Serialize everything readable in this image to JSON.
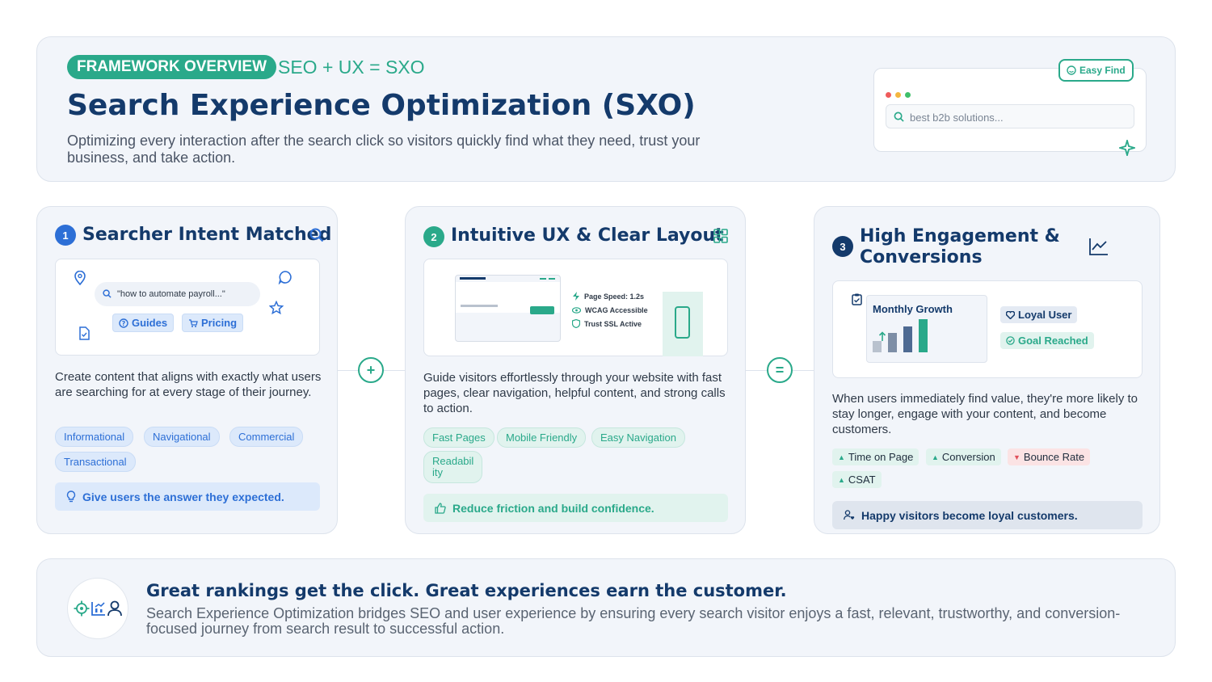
{
  "hero": {
    "badge": "FRAMEWORK OVERVIEW",
    "formula": "SEO + UX = SXO",
    "title": "Search Experience Optimization (SXO)",
    "subtitle": "Optimizing every interaction after the search click so visitors quickly find what they need, trust your business, and take action.",
    "easy_find": "Easy Find",
    "search_placeholder": "best b2b solutions..."
  },
  "cards": [
    {
      "num": "1",
      "title": "Searcher Intent Matched",
      "query": "\"how to automate payroll...\"",
      "guides": "Guides",
      "pricing": "Pricing",
      "desc": "Create content that aligns with exactly what users are searching for at every stage of their journey.",
      "tags": [
        "Informational",
        "Navigational",
        "Commercial",
        "Transactional"
      ],
      "note": "Give users the answer they expected."
    },
    {
      "num": "2",
      "title": "Intuitive UX & Clear Layout",
      "features": [
        "Page Speed: 1.2s",
        "WCAG Accessible",
        "Trust SSL Active"
      ],
      "desc": "Guide visitors effortlessly through your website with fast pages, clear navigation, helpful content, and strong calls to action.",
      "tags": [
        "Fast Pages",
        "Mobile Friendly",
        "Easy Navigation"
      ],
      "tag_readability": [
        "Readabil",
        "ity"
      ],
      "note": "Reduce friction and build confidence."
    },
    {
      "num": "3",
      "title_line1": "High Engagement &",
      "title_line2": "Conversions",
      "monthly": "Monthly Growth",
      "loyal": "Loyal User",
      "goal": "Goal Reached",
      "desc": "When users immediately find value, they're more likely to stay longer, engage with your content, and become customers.",
      "metrics": [
        "Time on Page",
        "Conversion",
        "Bounce Rate",
        "CSAT"
      ],
      "note": "Happy visitors become loyal customers."
    }
  ],
  "connectors": [
    "+",
    "="
  ],
  "footer": {
    "title": "Great rankings get the click. Great experiences earn the customer.",
    "text": "Search Experience Optimization bridges SEO and user experience by ensuring every search visitor enjoys a fast, relevant, trustworthy, and conversion-focused journey from search result to successful action."
  },
  "colors": {
    "accent": "#2aa98a",
    "navy": "#143a6b",
    "blue": "#2d6fd6",
    "red": "#e0505a"
  }
}
